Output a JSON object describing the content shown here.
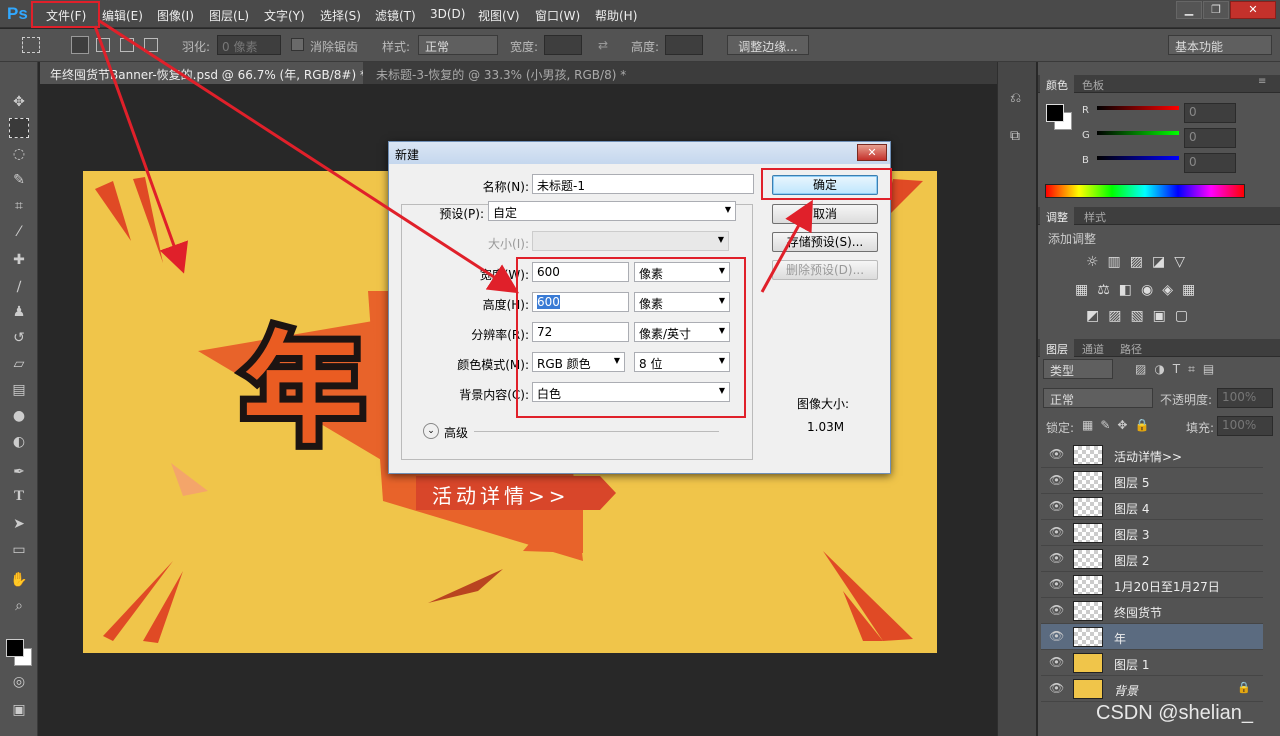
{
  "app": {
    "logo": "Ps"
  },
  "menu": [
    "文件(F)",
    "编辑(E)",
    "图像(I)",
    "图层(L)",
    "文字(Y)",
    "选择(S)",
    "滤镜(T)",
    "3D(D)",
    "视图(V)",
    "窗口(W)",
    "帮助(H)"
  ],
  "window_controls": {
    "minimize": "▁",
    "restore": "❐",
    "close": "✕"
  },
  "options": {
    "feather_label": "羽化:",
    "feather_value": "0 像素",
    "antialias_label": "消除锯齿",
    "style_label": "样式:",
    "style_value": "正常",
    "width_label": "宽度:",
    "height_label": "高度:",
    "refine_edge": "调整边缘...",
    "workspace": "基本功能"
  },
  "tabs": [
    {
      "label": "年终囤货节Banner-恢复的.psd @ 66.7% (年, RGB/8#) *",
      "active": true
    },
    {
      "label": "未标题-3-恢复的 @ 33.3% (小男孩, RGB/8) *",
      "active": false
    }
  ],
  "canvas": {
    "big_char": "年",
    "cta": "活动详情>>"
  },
  "dialog": {
    "title": "新建",
    "name_label": "名称(N):",
    "name_value": "未标题-1",
    "preset_label": "预设(P):",
    "preset_value": "自定",
    "size_label": "大小(I):",
    "width_label": "宽度(W):",
    "width_value": "600",
    "width_unit": "像素",
    "height_label": "高度(H):",
    "height_value": "600",
    "height_unit": "像素",
    "resolution_label": "分辨率(R):",
    "resolution_value": "72",
    "resolution_unit": "像素/英寸",
    "colormode_label": "颜色模式(M):",
    "colormode_value": "RGB 颜色",
    "bitdepth_value": "8 位",
    "bg_label": "背景内容(C):",
    "bg_value": "白色",
    "advanced_label": "高级",
    "ok": "确定",
    "cancel": "取消",
    "save_preset": "存储预设(S)...",
    "delete_preset": "删除预设(D)...",
    "image_size_label": "图像大小:",
    "image_size_value": "1.03M"
  },
  "color_panel": {
    "tabs": [
      "颜色",
      "色板"
    ],
    "channels": [
      {
        "label": "R",
        "value": "0"
      },
      {
        "label": "G",
        "value": "0"
      },
      {
        "label": "B",
        "value": "0"
      }
    ]
  },
  "adjust_panel": {
    "tabs": [
      "调整",
      "样式"
    ],
    "title": "添加调整"
  },
  "layers_panel": {
    "tabs": [
      "图层",
      "通道",
      "路径"
    ],
    "filter_label": "类型",
    "blend_mode": "正常",
    "opacity_label": "不透明度:",
    "opacity_value": "100%",
    "lock_label": "锁定:",
    "fill_label": "填充:",
    "fill_value": "100%",
    "layers": [
      {
        "name": "活动详情>>",
        "selected": false
      },
      {
        "name": "图层 5",
        "selected": false
      },
      {
        "name": "图层 4",
        "selected": false
      },
      {
        "name": "图层 3",
        "selected": false
      },
      {
        "name": "图层 2",
        "selected": false
      },
      {
        "name": "1月20日至1月27日",
        "selected": false
      },
      {
        "name": "终囤货节",
        "selected": false
      },
      {
        "name": "年",
        "selected": true
      },
      {
        "name": "图层 1",
        "selected": false
      },
      {
        "name": "背景",
        "selected": false
      }
    ]
  },
  "watermark": "CSDN @shelian_",
  "colors": {
    "accent_red": "#e0202a",
    "canvas_bg": "#f0c54a",
    "orange": "#e8632a"
  }
}
